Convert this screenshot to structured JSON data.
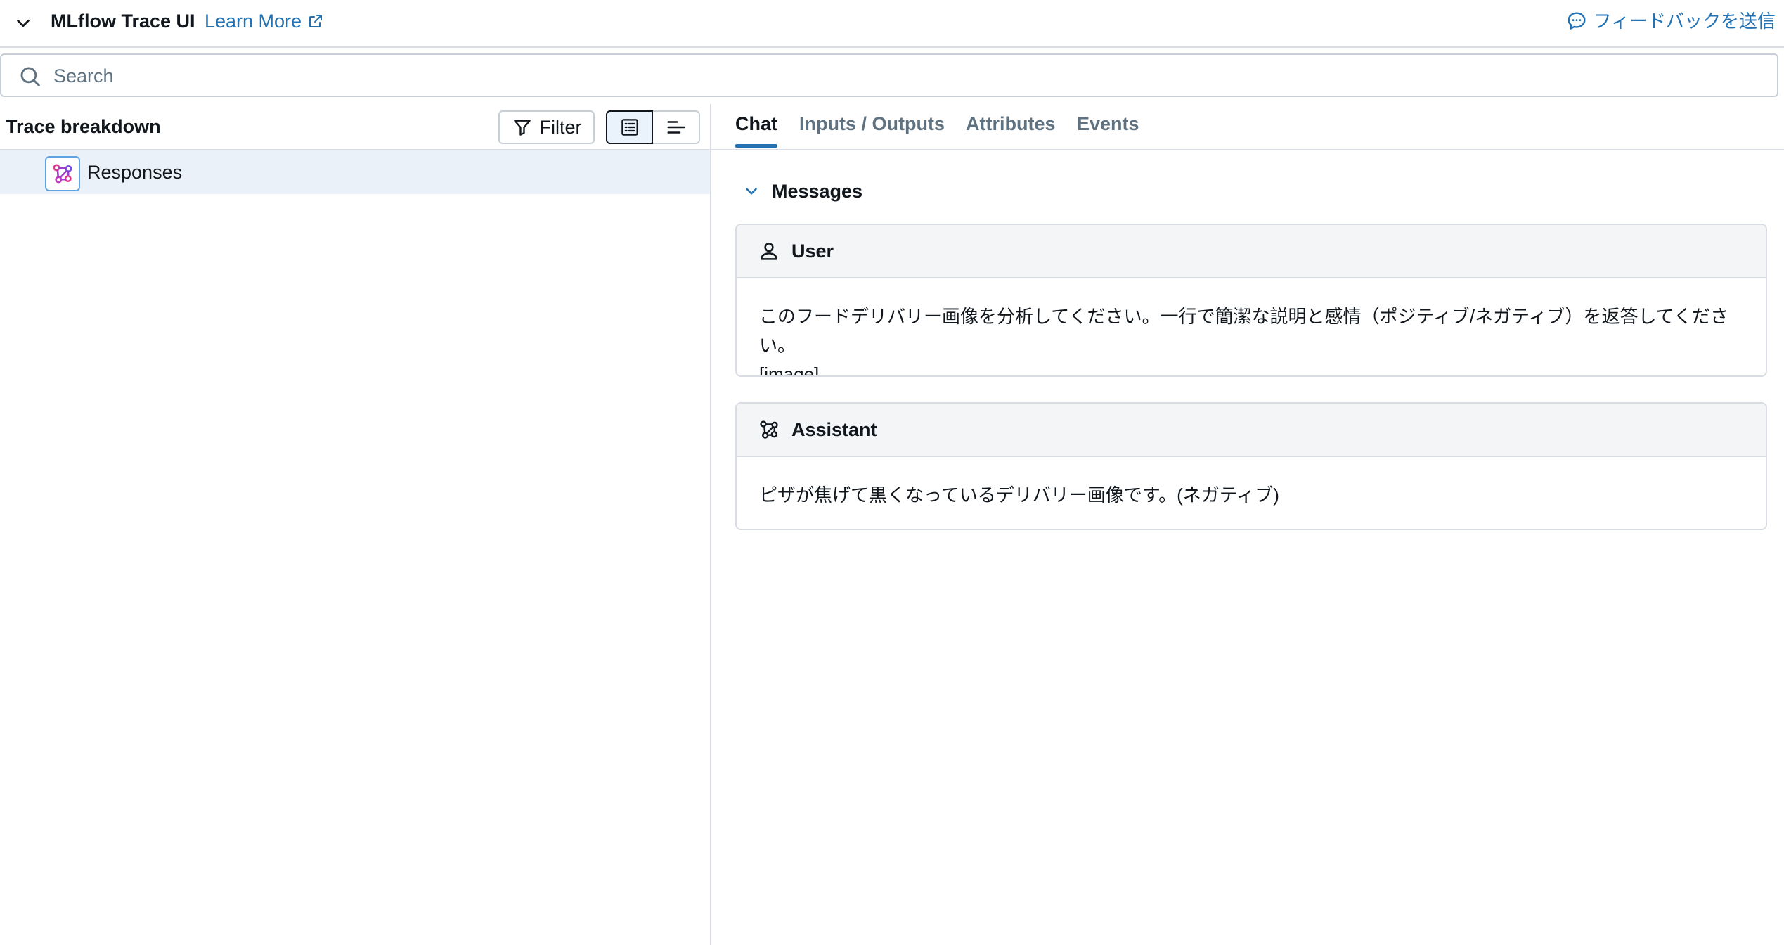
{
  "header": {
    "collapse_icon": "chevron-down-icon",
    "title": "MLflow Trace UI",
    "learn_more": "Learn More",
    "learn_more_icon": "external-link-icon",
    "feedback": "フィードバックを送信",
    "feedback_icon": "chat-bubble-icon"
  },
  "search": {
    "placeholder": "Search",
    "value": "",
    "icon": "search-icon"
  },
  "left_panel": {
    "title": "Trace breakdown",
    "filter_label": "Filter",
    "filter_icon": "funnel-icon",
    "view_modes": [
      {
        "icon": "list-view-icon",
        "active": true
      },
      {
        "icon": "timeline-view-icon",
        "active": false
      }
    ],
    "tree": [
      {
        "label": "Responses",
        "icon": "llm-span-icon",
        "selected": true
      }
    ]
  },
  "right_panel": {
    "tabs": [
      {
        "label": "Chat",
        "active": true
      },
      {
        "label": "Inputs / Outputs",
        "active": false
      },
      {
        "label": "Attributes",
        "active": false
      },
      {
        "label": "Events",
        "active": false
      }
    ],
    "messages_section": {
      "label": "Messages",
      "expanded": true,
      "items": [
        {
          "role": "User",
          "icon": "user-icon",
          "content_line1": "このフードデリバリー画像を分析してください。一行で簡潔な説明と感情（ポジティブ/ネガティブ）を返答してください。",
          "content_line2": "[image]"
        },
        {
          "role": "Assistant",
          "icon": "assistant-icon",
          "content_line1": "ピザが焦げて黒くなっているデリバリー画像です。(ネガティブ)"
        }
      ]
    }
  },
  "colors": {
    "link": "#2272b4",
    "selected_row": "#eaf1f8",
    "border": "#d9dde3",
    "muted_text": "#5f7281",
    "span_icon_pink": "#e0388f",
    "span_icon_purple": "#7b4be0"
  }
}
